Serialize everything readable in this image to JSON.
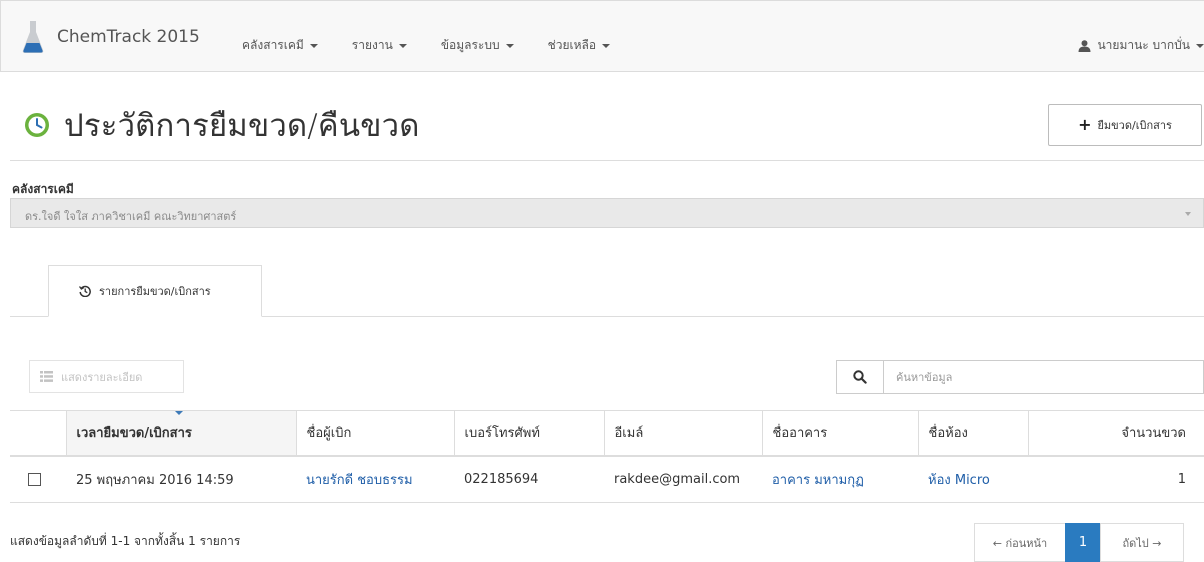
{
  "navbar": {
    "brand": "ChemTrack 2015",
    "menu": [
      {
        "label": "คลังสารเคมี"
      },
      {
        "label": "รายงาน"
      },
      {
        "label": "ข้อมูลระบบ"
      },
      {
        "label": "ช่วยเหลือ"
      }
    ],
    "user": "นายมานะ บากบั่น"
  },
  "header": {
    "title": "ประวัติการยืมขวด/คืนขวด",
    "borrow_button": "ยืมขวด/เบิกสาร"
  },
  "warehouse": {
    "label": "คลังสารเคมี",
    "selected": "ดร.ใจดี ใจใส ภาควิชาเคมี คณะวิทยาศาสตร์"
  },
  "tab": {
    "label": "รายการยืมขวด/เบิกสาร"
  },
  "toolbar": {
    "detail_button": "แสดงรายละเอียด",
    "search_placeholder": "ค้นหาข้อมูล"
  },
  "table": {
    "columns": [
      "เวลายืมขวด/เบิกสาร",
      "ชื่อผู้เบิก",
      "เบอร์โทรศัพท์",
      "อีเมล์",
      "ชื่ออาคาร",
      "ชื่อห้อง",
      "จำนวนขวด"
    ],
    "rows": [
      {
        "time": "25 พฤษภาคม 2016 14:59",
        "borrower": "นายรักดี ชอบธรรม",
        "phone": "022185694",
        "email": "rakdee@gmail.com",
        "building": "อาคาร มหามกุฏ",
        "room": "ห้อง Micro",
        "count": "1"
      }
    ]
  },
  "footer": {
    "info": "แสดงข้อมูลลำดับที่ 1-1 จากทั้งสิ้น 1 รายการ",
    "prev": "← ก่อนหน้า",
    "page": "1",
    "next": "ถัดไป →"
  },
  "colors": {
    "accent": "#2a7bc0",
    "link": "#1f5ea8"
  }
}
